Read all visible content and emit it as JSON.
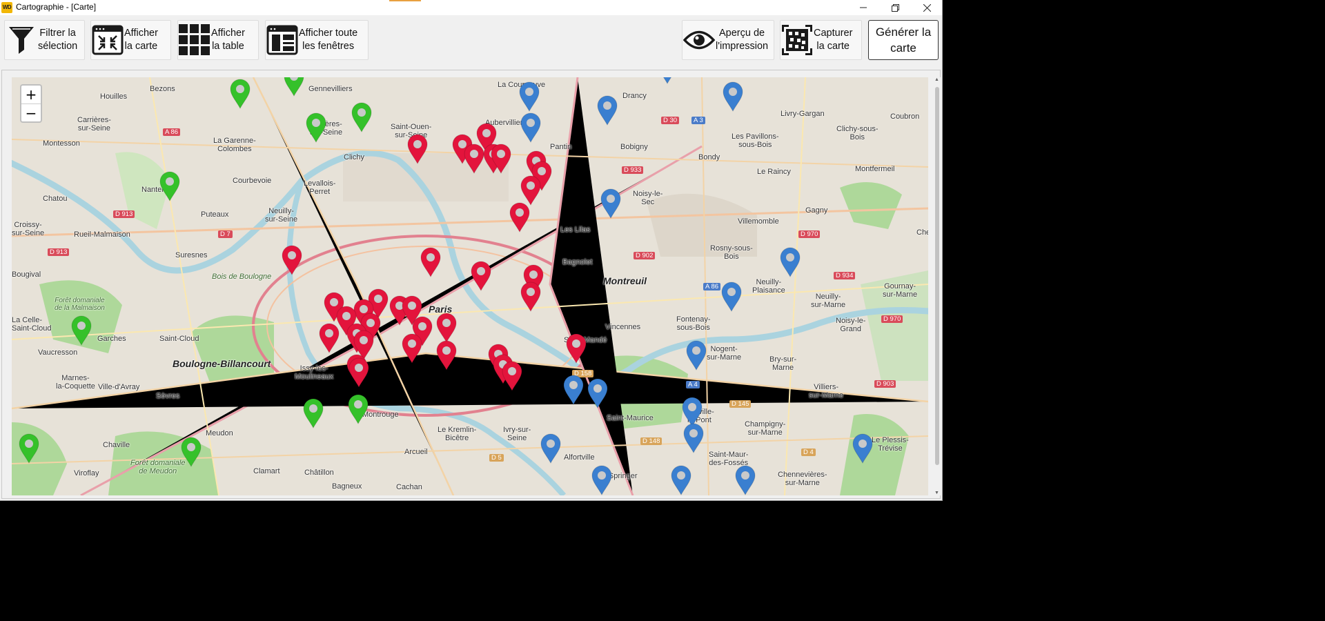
{
  "window": {
    "title": "Cartographie - [Carte]",
    "app_icon_text": "WD",
    "controls": [
      "minimize-icon",
      "restore-icon",
      "close-icon"
    ]
  },
  "toolbar": {
    "buttons": [
      {
        "label": "Filtrer la\nsélection",
        "icon": "filter-icon"
      },
      {
        "label": "Afficher\nla carte",
        "icon": "map-window-icon"
      },
      {
        "label": "Afficher\nla table",
        "icon": "grid-icon"
      },
      {
        "label": "Afficher toute\nles fenêtres",
        "icon": "windows-icon"
      },
      {
        "label": "Aperçu de\nl'impression",
        "icon": "eye-icon"
      },
      {
        "label": "Capturer\nla carte",
        "icon": "capture-icon"
      }
    ],
    "generate_label": "Générer la\ncarte"
  },
  "map": {
    "zoom_in": "+",
    "zoom_out": "−",
    "labels": {
      "bezons": "Bezons",
      "houilles": "Houilles",
      "carrieres": "Carrières-\nsur-Seine",
      "montesson": "Montesson",
      "garenne": "La Garenne-\nColombes",
      "courbevoie": "Courbevoie",
      "gennevilliers": "Gennevilliers",
      "asnieres": "Asnières-\nsur-Seine",
      "clichy": "Clichy",
      "levallois": "Levallois-\nPerret",
      "neuilly": "Neuilly-\nsur-Seine",
      "puteaux": "Puteaux",
      "nanterre": "Nanterre",
      "chatou": "Chatou",
      "croissy": "Croissy-\nsur-Seine",
      "rueil": "Rueil-Malmaison",
      "suresnes": "Suresnes",
      "bougival": "Bougival",
      "celle": "La Celle-\nSaint-Cloud",
      "vaucresson": "Vaucresson",
      "garches": "Garches",
      "saint_cloud": "Saint-Cloud",
      "boulogne": "Boulogne-Billancourt",
      "marnes": "Marnes-\nla-Coquette",
      "ville_avray": "Ville-d'Avray",
      "sevres": "Sèvres",
      "meudon": "Meudon",
      "chaville": "Chaville",
      "viroflay": "Viroflay",
      "clamart": "Clamart",
      "chatillon": "Châtillon",
      "bagneux": "Bagneux",
      "cachan": "Cachan",
      "arcueil": "Arcueil",
      "issy": "Issy-les-\nMoulineaux",
      "montrouge": "Montrouge",
      "kremlin": "Le Kremlin-\nBicêtre",
      "ivry": "Ivry-sur-\nSeine",
      "alfortville": "Alfortville",
      "biospringer": "BioSpringer",
      "saint_maurice": "Saint-Maurice",
      "paris": "Paris",
      "saint_ouen": "Saint-Ouen-\nsur-Seine",
      "aubervilliers": "Aubervilliers",
      "la_courneuve": "La Courneuve",
      "drancy": "Drancy",
      "bobigny": "Bobigny",
      "pantin": "Pantin",
      "les_lilas": "Les Lilas",
      "bagnolet": "Bagnolet",
      "montreuil": "Montreuil",
      "noisy_sec": "Noisy-le-\nSec",
      "bondy": "Bondy",
      "pavillons": "Les Pavillons-\nsous-Bois",
      "livry": "Livry-Gargan",
      "clichy_bois": "Clichy-sous-\nBois",
      "raincy": "Le Raincy",
      "montfermeil": "Montfermeil",
      "coubron": "Coubron",
      "villemomble": "Villemomble",
      "gagny": "Gagny",
      "rosny": "Rosny-sous-\nBois",
      "neuilly_plaisance": "Neuilly-\nPlaisance",
      "neuilly_marne": "Neuilly-\nsur-Marne",
      "gournay": "Gournay-\nsur-Marne",
      "noisy_grand": "Noisy-le-\nGrand",
      "fontenay": "Fontenay-\nsous-Bois",
      "vincennes": "Vincennes",
      "nogent": "Nogent-\nsur-Marne",
      "bry": "Bry-sur-\nMarne",
      "villiers": "Villiers-\nsur-Marne",
      "champigny": "Champigny-\nsur-Marne",
      "joinville": "Joinville-\nle-Pont",
      "saint_maur": "Saint-Maur-\ndes-Fossés",
      "chennevieres": "Chennevières-\nsur-Marne",
      "plessis": "Le Plessis-\nTrévise",
      "saint_mande": "Saint-Mandé",
      "bois_boulogne": "Bois de Boulogne",
      "foret_meudon": "Forêt domaniale\nde Meudon",
      "foret_malmaison": "Forêt domaniale\nde la Malmaison",
      "che": "Che"
    },
    "roads": [
      "A 86",
      "D 913",
      "D 7",
      "D 30",
      "A 3",
      "D 933",
      "D 902",
      "D 970",
      "D 934",
      "A 86",
      "D 970",
      "D 158",
      "D 148",
      "A 4",
      "D 145",
      "D 903",
      "D 5",
      "D 4",
      "D 913"
    ],
    "pins": {
      "green": "#35c12a",
      "red": "#e3143c",
      "blue": "#3a7fd0"
    }
  }
}
